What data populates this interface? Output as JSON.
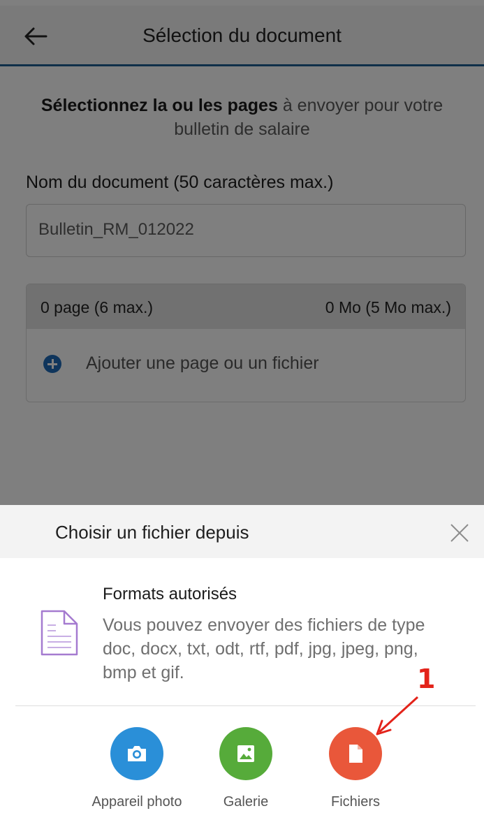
{
  "appbar": {
    "title": "Sélection du document"
  },
  "intro": {
    "bold": "Sélectionnez la ou les pages",
    "rest": " à envoyer pour votre bulletin de salaire"
  },
  "name_field": {
    "label": "Nom du document (50 caractères max.)",
    "value": "Bulletin_RM_012022"
  },
  "pages": {
    "count": "0 page (6 max.)",
    "size": "0 Mo (5 Mo max.)",
    "add_label": "Ajouter une page ou un fichier"
  },
  "sheet": {
    "title": "Choisir un fichier depuis",
    "formats_title": "Formats autorisés",
    "formats_desc": "Vous pouvez envoyer des fichiers de type doc, docx, txt, odt, rtf, pdf, jpg, jpeg, png, bmp et gif.",
    "actions": [
      {
        "label": "Appareil photo",
        "icon": "camera-icon",
        "color": "#2a8fd8"
      },
      {
        "label": "Galerie",
        "icon": "gallery-icon",
        "color": "#56ab3a"
      },
      {
        "label": "Fichiers",
        "icon": "file-icon",
        "color": "#e9573a"
      }
    ]
  },
  "annotation": {
    "number": "1",
    "color": "#e3231a"
  }
}
